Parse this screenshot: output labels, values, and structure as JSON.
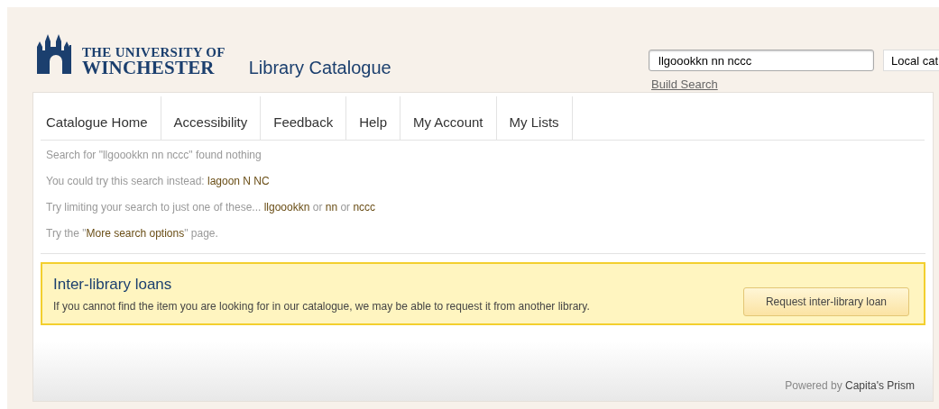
{
  "header": {
    "logo_line_1": "THE UNIVERSITY OF",
    "logo_line_2": "WINCHESTER",
    "title": "Library Catalogue"
  },
  "search": {
    "value": "llgoookkn nn nccc",
    "scope": "Local cat",
    "build_search": "Build Search"
  },
  "nav": [
    "Catalogue Home",
    "Accessibility",
    "Feedback",
    "Help",
    "My Account",
    "My Lists"
  ],
  "messages": [
    [
      {
        "kind": "text",
        "text": "Search for \"llgoookkn nn nccc\" found nothing"
      }
    ],
    [
      {
        "kind": "text",
        "text": "You could try this search instead: "
      },
      {
        "kind": "link",
        "text": "lagoon N NC"
      }
    ],
    [
      {
        "kind": "text",
        "text": "Try limiting your search to just one of these... "
      },
      {
        "kind": "link",
        "text": "llgoookkn"
      },
      {
        "kind": "text",
        "text": " or "
      },
      {
        "kind": "link",
        "text": "nn"
      },
      {
        "kind": "text",
        "text": " or "
      },
      {
        "kind": "link",
        "text": "nccc"
      }
    ],
    [
      {
        "kind": "text",
        "text": "Try the \""
      },
      {
        "kind": "link",
        "text": "More search options"
      },
      {
        "kind": "text",
        "text": "\" page."
      }
    ]
  ],
  "ill": {
    "title": "Inter-library loans",
    "text": "If you cannot find the item you are looking for in our catalogue, we may be able to request it from another library.",
    "button": "Request inter-library loan"
  },
  "footer": {
    "prefix": "Powered by",
    "link": "Capita's Prism"
  }
}
